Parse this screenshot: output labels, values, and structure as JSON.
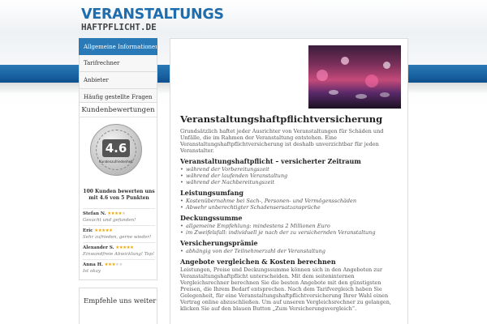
{
  "logo": {
    "line1": "VERANSTALTUNGS",
    "line2": "HAFTPFLICHT.DE"
  },
  "nav": {
    "items": [
      {
        "label": "Allgemeine Informationen",
        "active": true
      },
      {
        "label": "Tarifrechner",
        "active": false
      },
      {
        "label": "Anbieter",
        "active": false
      },
      {
        "label": "Häufig gestellte Fragen",
        "active": false
      }
    ]
  },
  "reviews": {
    "title": "Kundenbewertungen",
    "seal_score": "4.6",
    "seal_text": "Kundenzufriedenheit",
    "summary": "100 Kunden bewerten uns mit 4.6 von 5 Punkten",
    "items": [
      {
        "name": "Stefan N.",
        "stars": 4,
        "quote": "Gesucht und gefunden!"
      },
      {
        "name": "Eric",
        "stars": 5,
        "quote": "Sehr zufrieden, gerne wieder!"
      },
      {
        "name": "Alexander S.",
        "stars": 5,
        "quote": "Einwandfreie Abwicklung! Top!"
      },
      {
        "name": "Anna H.",
        "stars": 3,
        "quote": "Ist okay"
      }
    ]
  },
  "recommend": {
    "title": "Empfehle uns weiter"
  },
  "colors": {
    "brand_blue": "#1e6eaf",
    "band_blue": "#1a64a4",
    "star_gold": "#f0a800"
  },
  "content": {
    "title": "Veranstaltungshaftpflichtversicherung",
    "intro": "Grundsätzlich haftet jeder Ausrichter von Veranstaltungen für Schäden und Unfälle, die im Rahmen der Veranstaltung entstehen. Eine Veranstaltungshaftpflichtversicherung ist deshalb unverzichtbar für jeden Veranstalter.",
    "section1_title": "Veranstaltungshaftpflicht – versicherter Zeitraum",
    "section1_items": [
      "während der Vorbereitungszeit",
      "während der laufenden Veranstaltung",
      "während der Nachbereitungszeit"
    ],
    "section2_title": "Leistungsumfang",
    "section2_items": [
      "Kostenübernahme bei Sach-, Personen- und Vermögensschäden",
      "Abwehr unberechtigter Schadensersatzansprüche"
    ],
    "section3_title": "Deckungssumme",
    "section3_items": [
      "allgemeine Empfehlung: mindestens 2 Millionen Euro",
      "im Zweifelsfall: individuell je nach der zu versichernden Veranstaltung"
    ],
    "section4_title": "Versicherungsprämie",
    "section4_items": [
      "abhängig von der Teilnehmerzahl der Veranstaltung"
    ],
    "section5_title": "Angebote vergleichen & Kosten berechnen",
    "section5_text": "Leistungen, Preise und Deckungssumme können sich in den Angeboten zur Veranstaltungshaftpflicht unterscheiden. Mit dem seiteninternen Vergleichsrechner berechnen Sie die besten Angebote mit den günstigsten Preisen, die Ihrem Bedarf entsprechen. Nach dem Tarifvergleich haben Sie Gelegenheit, für eine Veranstaltungshaftpflichtversicherung Ihrer Wahl einen Vertrag online abzuschließen. Um auf unseren Vergleichsrechner zu gelangen, klicken Sie auf den blauen Button „Zum Versicherungsvergleich“."
  }
}
